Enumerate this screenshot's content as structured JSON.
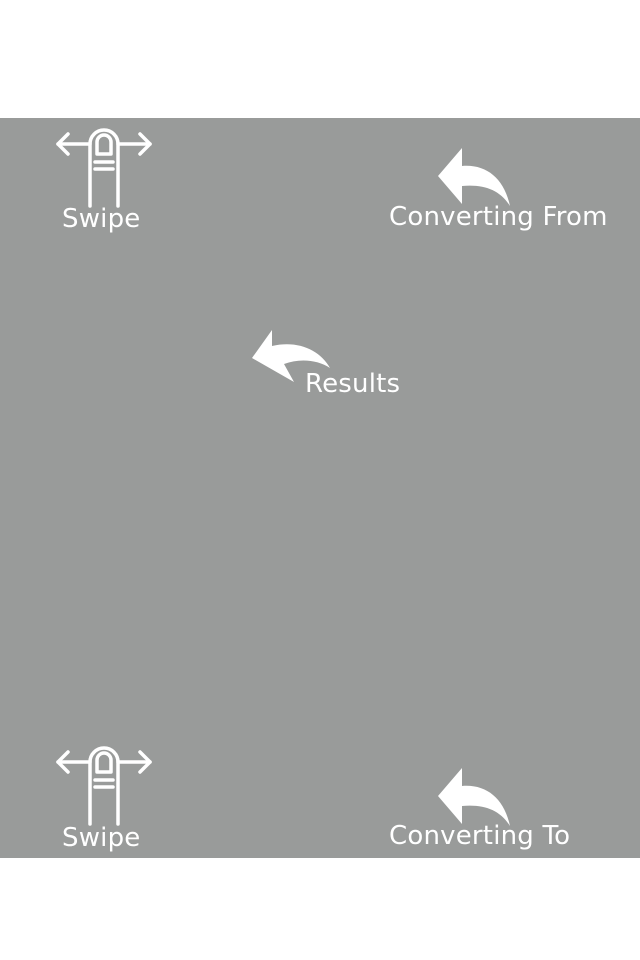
{
  "overlay": {
    "background_color": "#999b9a",
    "foreground_color": "#ffffff"
  },
  "hints": {
    "swipe_top": {
      "label": "Swipe",
      "icon": "swipe-finger-icon"
    },
    "converting_from": {
      "label": "Converting From",
      "icon": "curved-arrow-icon"
    },
    "results": {
      "label": "Results",
      "icon": "curved-arrow-icon"
    },
    "swipe_bottom": {
      "label": "Swipe",
      "icon": "swipe-finger-icon"
    },
    "converting_to": {
      "label": "Converting To",
      "icon": "curved-arrow-icon"
    }
  }
}
